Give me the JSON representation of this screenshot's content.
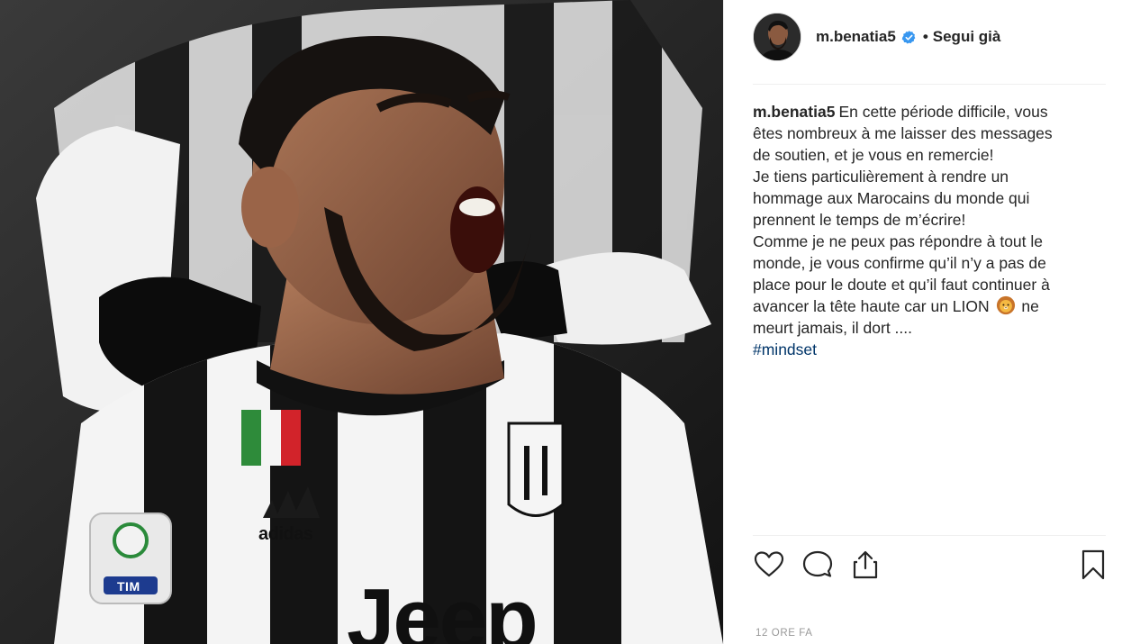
{
  "post": {
    "image": {
      "jersey_text": "Jeep",
      "brand_text": "adidas",
      "sponsor_text": "TIM"
    },
    "header": {
      "username": "m.benatia5",
      "verified_icon": "verified-badge-icon",
      "separator": "•",
      "follow_label": "Segui già"
    },
    "caption": {
      "username": "m.benatia5",
      "lines": [
        "En cette période difficile, vous",
        "êtes nombreux à me laisser des messages",
        "de soutien, et je vous en remercie!",
        "Je tiens particulièrement à rendre un",
        "hommage aux Marocains du monde qui",
        "prennent le temps de m’écrire!",
        "Comme je ne peux pas répondre à tout le",
        "monde, je vous confirme qu’il n’y a pas de",
        "place pour le doute et qu’il faut continuer à",
        "avancer la tête haute car un LION",
        "ne",
        "meurt jamais, il dort ...."
      ],
      "emoji": "lion-emoji",
      "hashtag": "#mindset"
    },
    "actions": {
      "like": "heart-icon",
      "comment": "comment-icon",
      "share": "share-icon",
      "save": "bookmark-icon"
    },
    "timestamp": "12 ORE FA"
  },
  "colors": {
    "text": "#262626",
    "hashtag": "#003569",
    "verified": "#3897f0",
    "timestamp": "#999999",
    "divider": "#efefef"
  }
}
